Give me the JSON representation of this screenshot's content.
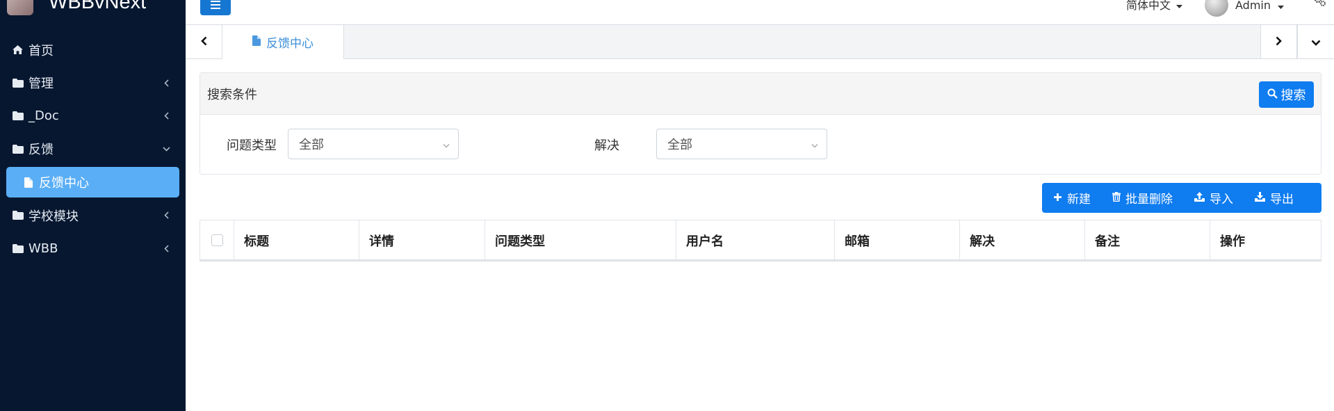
{
  "app": {
    "name": "WBBvNext"
  },
  "sidebar": {
    "items": [
      {
        "label": "首页",
        "icon": "home-icon"
      },
      {
        "label": "管理",
        "icon": "folder-icon"
      },
      {
        "label": "_Doc",
        "icon": "folder-icon"
      },
      {
        "label": "反馈",
        "icon": "folder-icon"
      },
      {
        "label": "反馈中心",
        "icon": "file-icon",
        "active": true
      },
      {
        "label": "学校模块",
        "icon": "folder-icon"
      },
      {
        "label": "WBB",
        "icon": "folder-icon"
      }
    ]
  },
  "topbar": {
    "language": "简体中文",
    "user": "Admin"
  },
  "tabs": [
    {
      "label": "反馈中心",
      "icon": "file-icon"
    }
  ],
  "search": {
    "title": "搜索条件",
    "button": "搜索",
    "fields": [
      {
        "label": "问题类型",
        "value": "全部"
      },
      {
        "label": "解决",
        "value": "全部"
      }
    ]
  },
  "actions": {
    "new": "新建",
    "batch_delete": "批量删除",
    "import": "导入",
    "export": "导出"
  },
  "table": {
    "columns": [
      "标题",
      "详情",
      "问题类型",
      "用户名",
      "邮箱",
      "解决",
      "备注",
      "操作"
    ]
  },
  "colors": {
    "sidebar_bg": "#071730",
    "accent": "#0f7cf0",
    "active_menu": "#5aaef6",
    "tab_active_text": "#3c8fd9"
  }
}
